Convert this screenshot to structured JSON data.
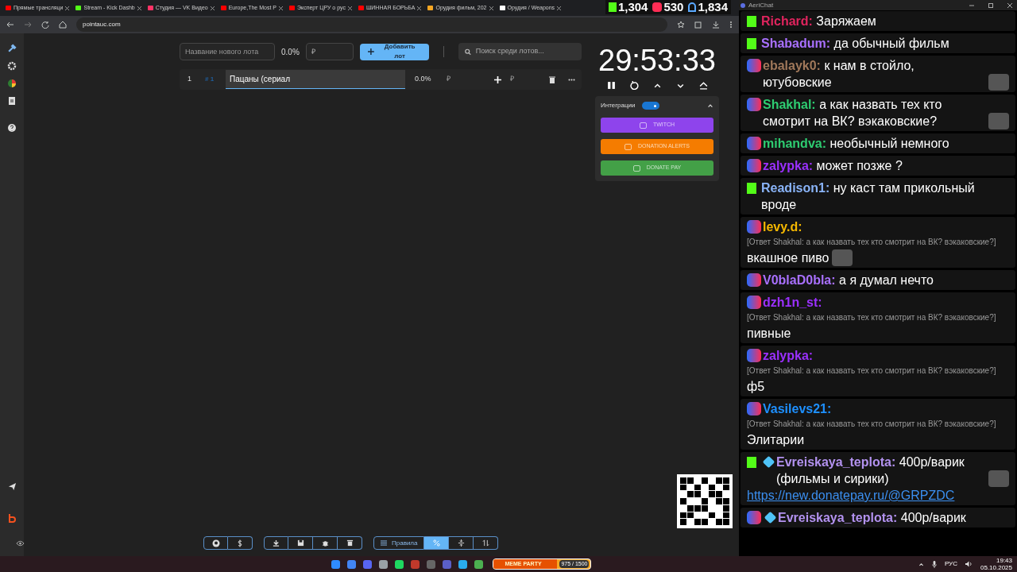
{
  "browser": {
    "tabs": [
      {
        "title": "Прямые трансляци",
        "color": "#ff0000"
      },
      {
        "title": "Stream - Kick Dashb",
        "color": "#53fc18"
      },
      {
        "title": "Студия — VK Видео",
        "color": "#ff3366"
      },
      {
        "title": "Europe,The Most P",
        "color": "#ff0000"
      },
      {
        "title": "Эксперт ЦРУ о рус",
        "color": "#ff0000"
      },
      {
        "title": "ШИННАЯ БОРЬБА",
        "color": "#ff0000"
      },
      {
        "title": "Орудия фильм, 202",
        "color": "#f5a623"
      },
      {
        "title": "Орудия / Weapons",
        "color": "#ffffff"
      }
    ],
    "address": "pointauc.com"
  },
  "stream_stats": [
    {
      "kind": "kick",
      "value": "1,304"
    },
    {
      "kind": "vk",
      "value": "530"
    },
    {
      "kind": "viewers",
      "value": "1,834"
    }
  ],
  "auction": {
    "new_lot": {
      "placeholder": "Название нового лота",
      "percent": "0.0%",
      "amount_placeholder": "₽",
      "add_button": "Добавить лот"
    },
    "search": {
      "placeholder": "Поиск среди лотов..."
    },
    "lots": [
      {
        "index": "1",
        "number": "# 1",
        "name": "Пацаны (сериал",
        "percent": "0.0%",
        "amount_placeholder": "₽",
        "add_amount_placeholder": "₽"
      }
    ],
    "timer": "29:53:33",
    "integrations": {
      "label": "Интеграции",
      "on": true,
      "buttons": [
        {
          "kind": "twitch",
          "label": "TWITCH"
        },
        {
          "kind": "donationalerts",
          "label": "DONATION ALERTS"
        },
        {
          "kind": "donatepay",
          "label": "DONATE PAY"
        }
      ]
    },
    "toolbar": {
      "rules_button": "Правила",
      "percent_selected": true
    }
  },
  "taskbar_widget": {
    "title": "MEME PARTY",
    "progress": "975 / 1500",
    "level": 0.65
  },
  "chat": {
    "title": "AeriChat",
    "messages": [
      {
        "kind": "kick",
        "name": "Richard:",
        "color": "#e0245e",
        "text": "Заряжаем"
      },
      {
        "kind": "kick",
        "name": "Shabadum:",
        "color": "#a970ff",
        "text": "да обычный фильм"
      },
      {
        "kind": "vk",
        "name": "ebalayk0:",
        "color": "#a0785a",
        "text": "к нам в стойло, ютубовские",
        "emote": true
      },
      {
        "kind": "vk",
        "name": "Shakhal:",
        "color": "#2ecc71",
        "text": "а как назвать тех кто смотрит на ВК? вэкаковские?",
        "emote": true
      },
      {
        "kind": "vk",
        "name": "mihandva:",
        "color": "#2ecc71",
        "text": "необычный немного"
      },
      {
        "kind": "vk",
        "name": "zalypka:",
        "color": "#9b30ff",
        "text": "может позже ?"
      },
      {
        "kind": "kick",
        "name": "Readison1:",
        "color": "#8ab4f8",
        "text": "ну каст там прикольный вроде"
      },
      {
        "kind": "vk",
        "name": "levy.d:",
        "color": "#f5b800",
        "reply": "[Ответ Shakhal: а как назвать тех кто смотрит на ВК? вэкаковские?]",
        "text": "вкашное пиво",
        "emote": true
      },
      {
        "kind": "vk",
        "name": "V0blaD0bla:",
        "color": "#a970ff",
        "text": "а я думал нечто"
      },
      {
        "kind": "vk",
        "name": "dzh1n_st:",
        "color": "#9b30ff",
        "reply": "[Ответ Shakhal: а как назвать тех кто смотрит на ВК? вэкаковские?]",
        "text": "пивные"
      },
      {
        "kind": "vk",
        "name": "zalypka:",
        "color": "#9b30ff",
        "reply": "[Ответ Shakhal: а как назвать тех кто смотрит на ВК? вэкаковские?]",
        "text": "ф5"
      },
      {
        "kind": "vk",
        "name": "Vasilevs21:",
        "color": "#1e90ff",
        "reply": "[Ответ Shakhal: а как назвать тех кто смотрит на ВК? вэкаковские?]",
        "text": "Элитарии"
      },
      {
        "kind": "kick",
        "name": "Evreiskaya_teplota:",
        "color": "#b392f0",
        "badge": true,
        "text": "400р/варик (фильмы и сирики)",
        "emote": true,
        "link": "https://new.donatepay.ru/@GRPZDC"
      },
      {
        "kind": "vk",
        "name": "Evreiskaya_teplota:",
        "color": "#b392f0",
        "badge": true,
        "text": "400р/варик"
      }
    ]
  },
  "tray": {
    "language": "РУС",
    "time": "19:43",
    "date": "05.10.2025"
  }
}
